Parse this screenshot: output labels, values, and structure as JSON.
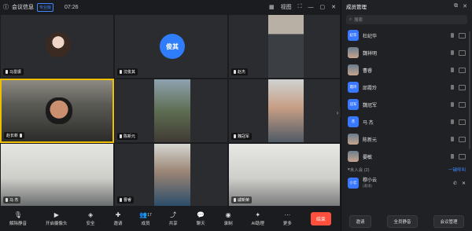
{
  "title": {
    "app": "会议信息",
    "badge": "专业版",
    "time": "07:26",
    "layout": "视图"
  },
  "tiles": [
    {
      "name": "马雷振"
    },
    {
      "name": "沈俊其",
      "avatar": "俊其"
    },
    {
      "name": "赵杰"
    },
    {
      "name": "赵长新"
    },
    {
      "name": "陈新元"
    },
    {
      "name": "魏冠军"
    },
    {
      "name": "马  杰"
    },
    {
      "name": "曹睿"
    },
    {
      "name": "高英"
    },
    {
      "name": "戚新荣"
    }
  ],
  "bottombar": [
    {
      "label": "解除静音",
      "icon": "mic-off-icon"
    },
    {
      "label": "开启摄像头",
      "icon": "camera-off-icon"
    },
    {
      "label": "安全",
      "icon": "shield-icon"
    },
    {
      "label": "邀请",
      "icon": "invite-icon"
    },
    {
      "label": "成员",
      "icon": "members-icon",
      "count": "17"
    },
    {
      "label": "共享",
      "icon": "share-icon"
    },
    {
      "label": "聊天",
      "icon": "chat-icon"
    },
    {
      "label": "录制",
      "icon": "record-icon"
    },
    {
      "label": "AI助理",
      "icon": "ai-icon"
    },
    {
      "label": "更多",
      "icon": "more-icon"
    }
  ],
  "end_label": "结束",
  "panel": {
    "title": "成员管理",
    "search_placeholder": "搜索",
    "members": [
      {
        "name": "杜纪华",
        "av": "纪华"
      },
      {
        "name": "魏祥明",
        "av": ""
      },
      {
        "name": "曹睿",
        "av": ""
      },
      {
        "name": "邱霞玲",
        "av": "霞玲"
      },
      {
        "name": "魏冠军",
        "av": "冠军"
      },
      {
        "name": "马  杰",
        "av": "杰"
      },
      {
        "name": "陈新元",
        "av": ""
      },
      {
        "name": "晏敏",
        "av": ""
      }
    ],
    "section_label": "未入会 (2)",
    "section_link": "一键呼叫",
    "pending": [
      {
        "name": "穆小云",
        "sub": "(邀请)",
        "av": "小云"
      }
    ],
    "buttons": [
      "邀请",
      "全员静音",
      "会议管理"
    ]
  }
}
